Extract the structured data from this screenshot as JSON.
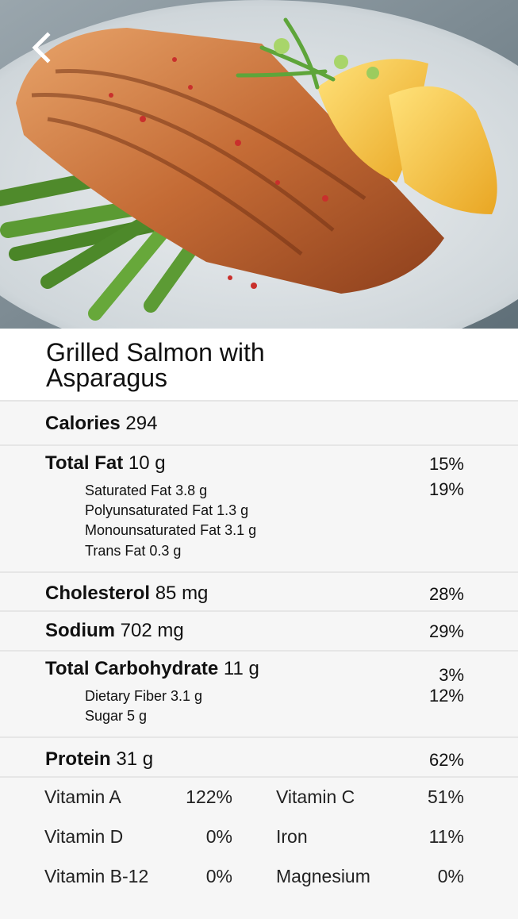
{
  "header": {
    "back_icon": "chevron-left-icon"
  },
  "recipe": {
    "title": "Grilled Salmon with Asparagus"
  },
  "nutrition": {
    "calories": {
      "label": "Calories",
      "value": "294"
    },
    "total_fat": {
      "label": "Total Fat",
      "value": "10 g",
      "percent": "15%",
      "sub": [
        {
          "text": "Saturated Fat 3.8 g",
          "percent": "19%"
        },
        {
          "text": "Polyunsaturated Fat 1.3 g"
        },
        {
          "text": "Monounsaturated Fat 3.1 g"
        },
        {
          "text": "Trans Fat 0.3 g"
        }
      ]
    },
    "cholesterol": {
      "label": "Cholesterol",
      "value": "85 mg",
      "percent": "28%"
    },
    "sodium": {
      "label": "Sodium",
      "value": "702 mg",
      "percent": "29%"
    },
    "total_carbohydrate": {
      "label": "Total Carbohydrate",
      "value": "11 g",
      "percent": "3%",
      "sub": [
        {
          "text": "Dietary Fiber 3.1 g",
          "percent": "12%"
        },
        {
          "text": "Sugar 5 g"
        }
      ]
    },
    "protein": {
      "label": "Protein",
      "value": "31 g",
      "percent": "62%"
    },
    "vitamins": [
      {
        "name": "Vitamin A",
        "value": "122%"
      },
      {
        "name": "Vitamin C",
        "value": "51%"
      },
      {
        "name": "Vitamin D",
        "value": "0%"
      },
      {
        "name": "Iron",
        "value": "11%"
      },
      {
        "name": "Vitamin B-12",
        "value": "0%"
      },
      {
        "name": "Magnesium",
        "value": "0%"
      }
    ]
  }
}
